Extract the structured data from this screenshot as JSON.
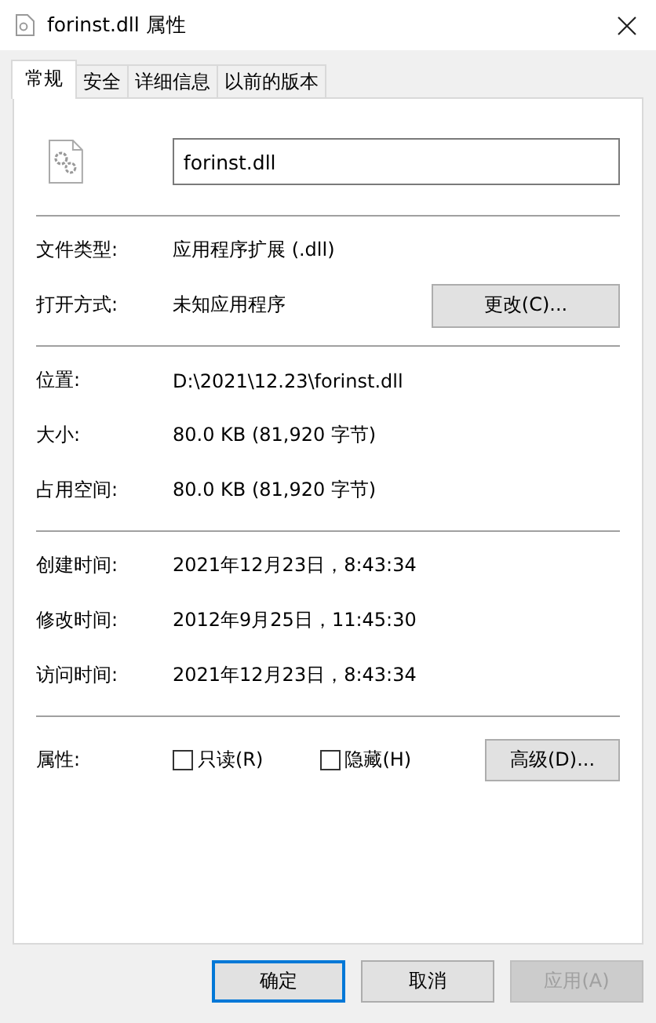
{
  "window": {
    "title": "forinst.dll 属性"
  },
  "tabs": [
    {
      "label": "常规",
      "selected": true
    },
    {
      "label": "安全",
      "selected": false
    },
    {
      "label": "详细信息",
      "selected": false
    },
    {
      "label": "以前的版本",
      "selected": false
    }
  ],
  "file_name": {
    "value": "forinst.dll"
  },
  "sections": [
    [
      {
        "label": "文件类型:",
        "value": "应用程序扩展 (.dll)"
      },
      {
        "label": "打开方式:",
        "value": "未知应用程序",
        "button": "更改(C)..."
      }
    ],
    [
      {
        "label": "位置:",
        "value": "D:\\2021\\12.23\\forinst.dll"
      },
      {
        "label": "大小:",
        "value": "80.0 KB (81,920 字节)"
      },
      {
        "label": "占用空间:",
        "value": "80.0 KB (81,920 字节)"
      }
    ],
    [
      {
        "label": "创建时间:",
        "value": "2021年12月23日，8:43:34"
      },
      {
        "label": "修改时间:",
        "value": "2012年9月25日，11:45:30"
      },
      {
        "label": "访问时间:",
        "value": "2021年12月23日，8:43:34"
      }
    ]
  ],
  "attributes": {
    "label": "属性:",
    "checkboxes": [
      {
        "label": "只读(R)",
        "checked": false
      },
      {
        "label": "隐藏(H)",
        "checked": false
      }
    ],
    "button": "高级(D)..."
  },
  "buttons": [
    {
      "label": "确定",
      "default": true,
      "disabled": false
    },
    {
      "label": "取消",
      "default": false,
      "disabled": false
    },
    {
      "label": "应用(A)",
      "default": false,
      "disabled": true
    }
  ]
}
